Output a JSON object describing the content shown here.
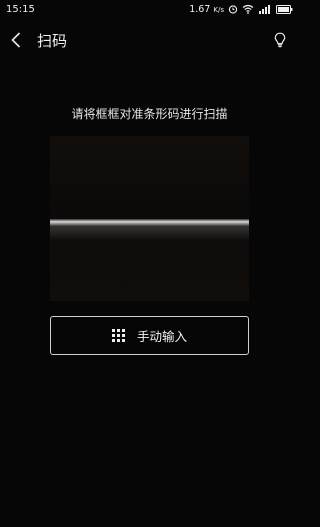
{
  "status_bar": {
    "time": "15:15",
    "speed_value": "1.67",
    "speed_unit": "K/s",
    "icons": [
      "alarm-icon",
      "wifi-icon",
      "signal-icon",
      "battery-icon"
    ]
  },
  "app_bar": {
    "back_icon": "chevron-left-icon",
    "title": "扫码",
    "light_icon": "lightbulb-icon"
  },
  "scanner": {
    "hint": "请将框框对准条形码进行扫描"
  },
  "manual_input": {
    "icon": "keypad-icon",
    "label": "手动输入"
  },
  "colors": {
    "background": "#060606",
    "text": "#f2f2f2",
    "button_border": "#cfcfcf"
  }
}
